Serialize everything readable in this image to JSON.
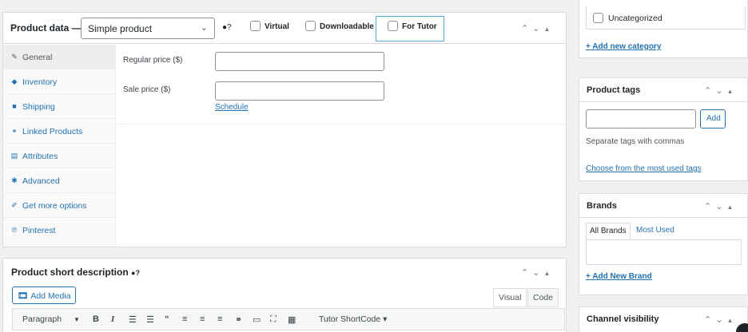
{
  "product_data": {
    "title": "Product data —",
    "type_select": "Simple product",
    "options": {
      "virtual": "Virtual",
      "downloadable": "Downloadable",
      "for_tutor": "For Tutor"
    },
    "tabs": [
      {
        "label": "General",
        "icon": "wrench-icon",
        "glyph": "✎"
      },
      {
        "label": "Inventory",
        "icon": "tag-icon",
        "glyph": "◆"
      },
      {
        "label": "Shipping",
        "icon": "truck-icon",
        "glyph": "■"
      },
      {
        "label": "Linked Products",
        "icon": "link-icon",
        "glyph": "⚭"
      },
      {
        "label": "Attributes",
        "icon": "list-icon",
        "glyph": "▤"
      },
      {
        "label": "Advanced",
        "icon": "gear-icon",
        "glyph": "✱"
      },
      {
        "label": "Get more options",
        "icon": "plugin-icon",
        "glyph": "✐"
      },
      {
        "label": "Pinterest",
        "icon": "pinterest-icon",
        "glyph": "℗"
      }
    ],
    "regular_price_label": "Regular price ($)",
    "regular_price_value": "",
    "sale_price_label": "Sale price ($)",
    "sale_price_value": "",
    "schedule_link": "Schedule"
  },
  "short_description": {
    "title": "Product short description",
    "add_media": "Add Media",
    "tab_visual": "Visual",
    "tab_code": "Code",
    "format_select": "Paragraph",
    "shortcode": "Tutor ShortCode"
  },
  "sidebar": {
    "uncategorized": "Uncategorized",
    "add_category": "+ Add new category",
    "tags_title": "Product tags",
    "tags_input": "",
    "tags_add": "Add",
    "tags_hint": "Separate tags with commas",
    "tags_choose": "Choose from the most used tags",
    "brands_title": "Brands",
    "brands_all": "All Brands",
    "brands_most": "Most Used",
    "add_brand": "+ Add New Brand",
    "channel_title": "Channel visibility"
  },
  "colors": {
    "accent": "#2271b1",
    "tutor_highlight": "#55acd8"
  }
}
